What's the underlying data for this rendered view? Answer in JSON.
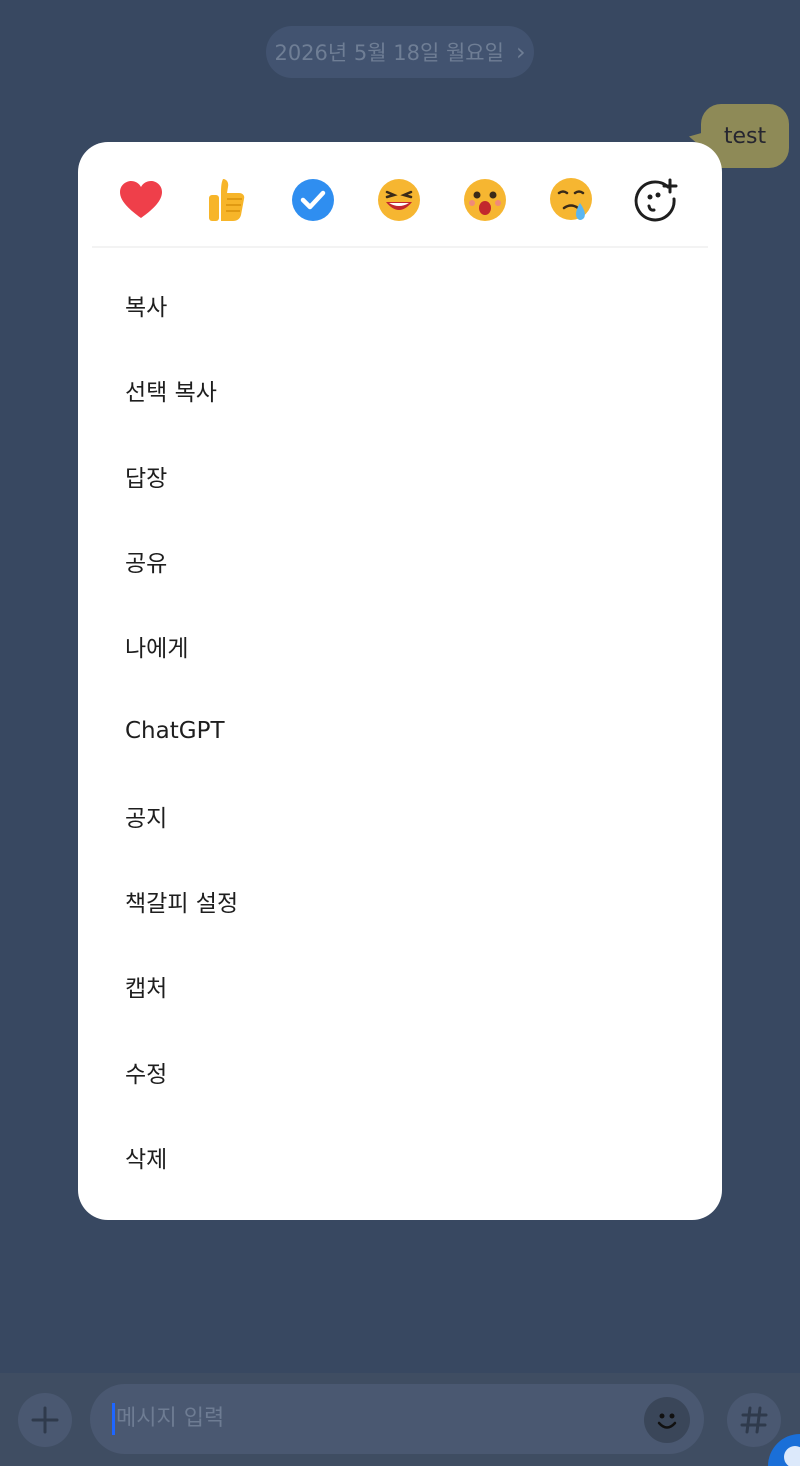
{
  "chat": {
    "date_label": "2026년 5월 18일 월요일",
    "message_text": "test"
  },
  "reactions": [
    {
      "name": "heart-icon"
    },
    {
      "name": "thumbs-up-icon"
    },
    {
      "name": "check-icon"
    },
    {
      "name": "laughing-face-icon"
    },
    {
      "name": "surprised-face-icon"
    },
    {
      "name": "crying-face-icon"
    },
    {
      "name": "add-reaction-icon"
    }
  ],
  "menu": {
    "items": [
      "복사",
      "선택 복사",
      "답장",
      "공유",
      "나에게",
      "ChatGPT",
      "공지",
      "책갈피 설정",
      "캡처",
      "수정",
      "삭제"
    ]
  },
  "input": {
    "placeholder": "메시지 입력"
  },
  "colors": {
    "background": "#384861",
    "bubble": "#8e8a57",
    "accent": "#1a6fd8"
  }
}
